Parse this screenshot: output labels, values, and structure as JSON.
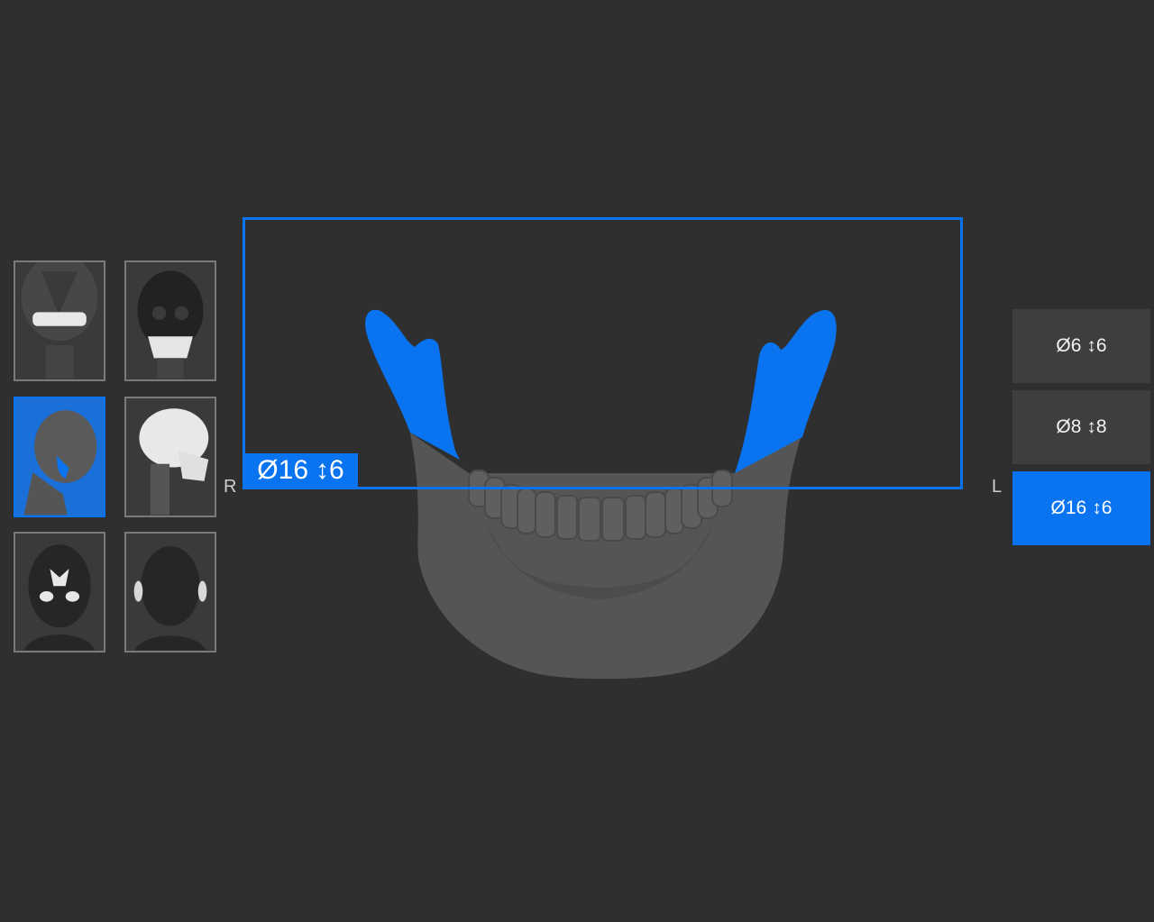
{
  "thumbnails": [
    {
      "name": "frontal-jaw-teeth",
      "selected": false
    },
    {
      "name": "frontal-skull",
      "selected": false
    },
    {
      "name": "lateral-mandible-ramus",
      "selected": true
    },
    {
      "name": "lateral-skull",
      "selected": false
    },
    {
      "name": "frontal-sinus",
      "selected": false
    },
    {
      "name": "frontal-ears",
      "selected": false
    }
  ],
  "labels": {
    "right": "R",
    "left": "L"
  },
  "fov_tag": {
    "diameter": "Ø16",
    "height": "6",
    "arrow": "↕"
  },
  "fov_options": [
    {
      "diameter": "Ø6",
      "arrow": "↕",
      "height": "6",
      "active": false
    },
    {
      "diameter": "Ø8",
      "arrow": "↕",
      "height": "8",
      "active": false
    },
    {
      "diameter": "Ø16",
      "arrow": "↕",
      "height": "6",
      "active": true
    }
  ],
  "colors": {
    "accent": "#0a74f0",
    "background": "#2f2f2f",
    "bone": "#5a5a5a"
  }
}
